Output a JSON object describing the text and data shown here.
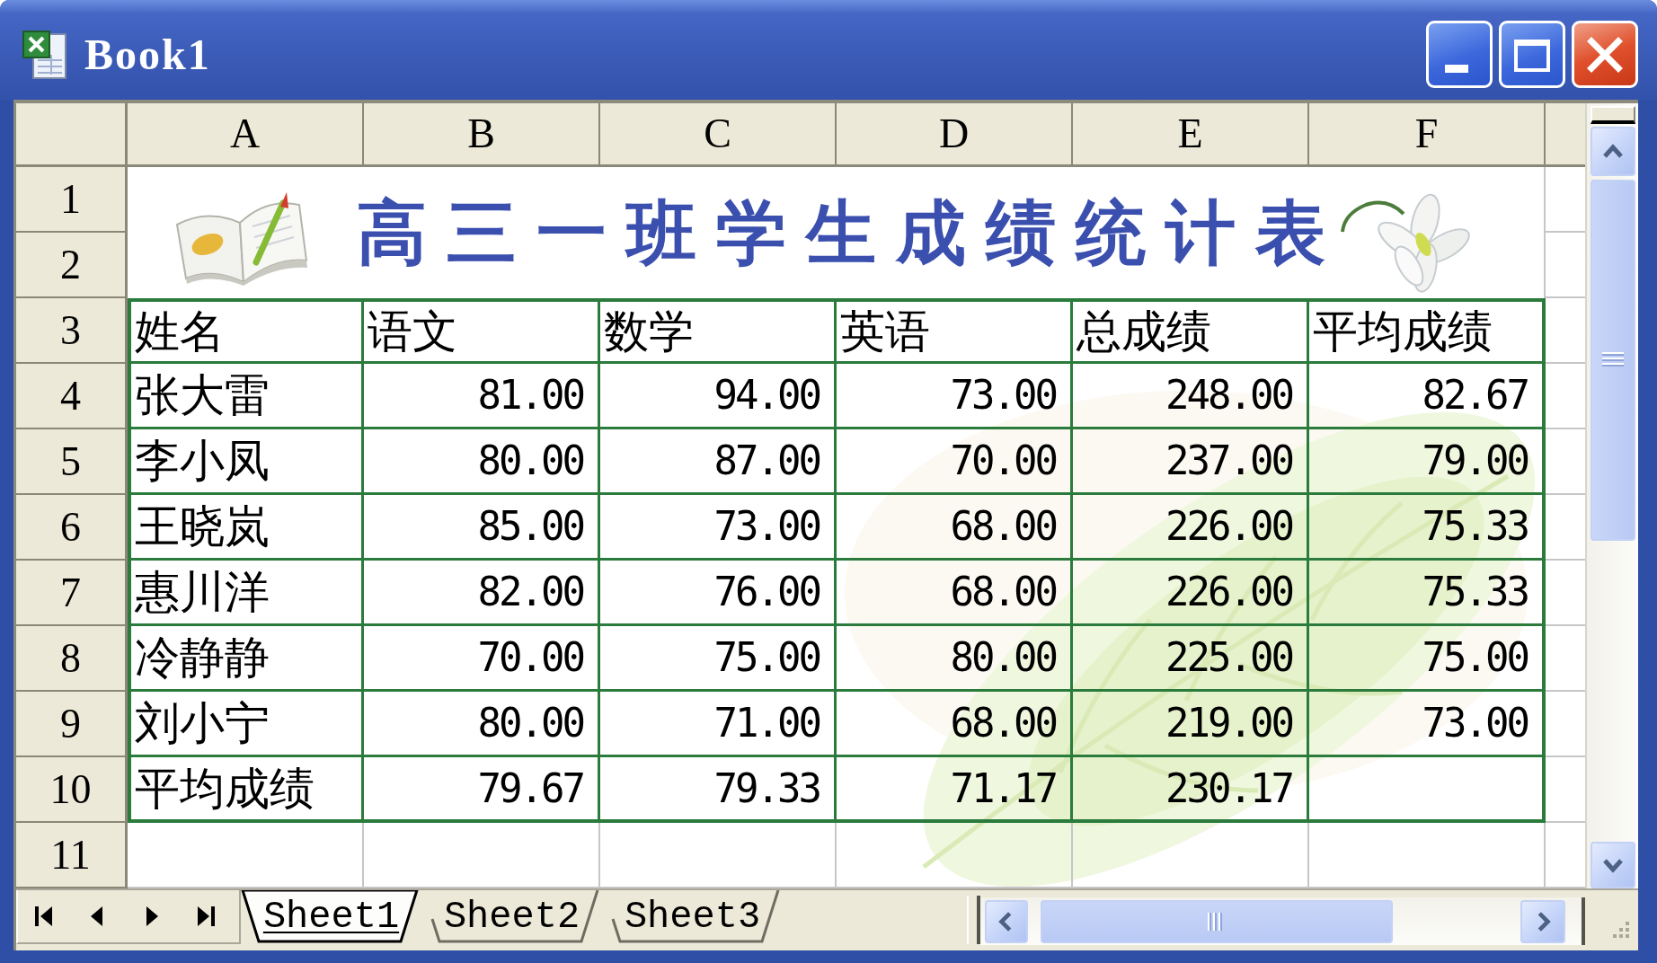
{
  "window": {
    "title": "Book1"
  },
  "column_headers": [
    "A",
    "B",
    "C",
    "D",
    "E",
    "F"
  ],
  "row_headers": [
    "1",
    "2",
    "3",
    "4",
    "5",
    "6",
    "7",
    "8",
    "9",
    "10",
    "11"
  ],
  "sheet_title": "高三一班学生成绩统计表",
  "table": {
    "columns": [
      "姓名",
      "语文",
      "数学",
      "英语",
      "总成绩",
      "平均成绩"
    ],
    "rows": [
      [
        "张大雷",
        "81.00",
        "94.00",
        "73.00",
        "248.00",
        "82.67"
      ],
      [
        "李小凤",
        "80.00",
        "87.00",
        "70.00",
        "237.00",
        "79.00"
      ],
      [
        "王晓岚",
        "85.00",
        "73.00",
        "68.00",
        "226.00",
        "75.33"
      ],
      [
        "惠川洋",
        "82.00",
        "76.00",
        "68.00",
        "226.00",
        "75.33"
      ],
      [
        "冷静静",
        "70.00",
        "75.00",
        "80.00",
        "225.00",
        "75.00"
      ],
      [
        "刘小宁",
        "80.00",
        "71.00",
        "68.00",
        "219.00",
        "73.00"
      ],
      [
        "平均成绩",
        "79.67",
        "79.33",
        "71.17",
        "230.17"
      ]
    ]
  },
  "sheet_tabs": [
    {
      "label": "Sheet1",
      "selected": true
    },
    {
      "label": "Sheet2",
      "selected": false
    },
    {
      "label": "Sheet3",
      "selected": false
    }
  ]
}
